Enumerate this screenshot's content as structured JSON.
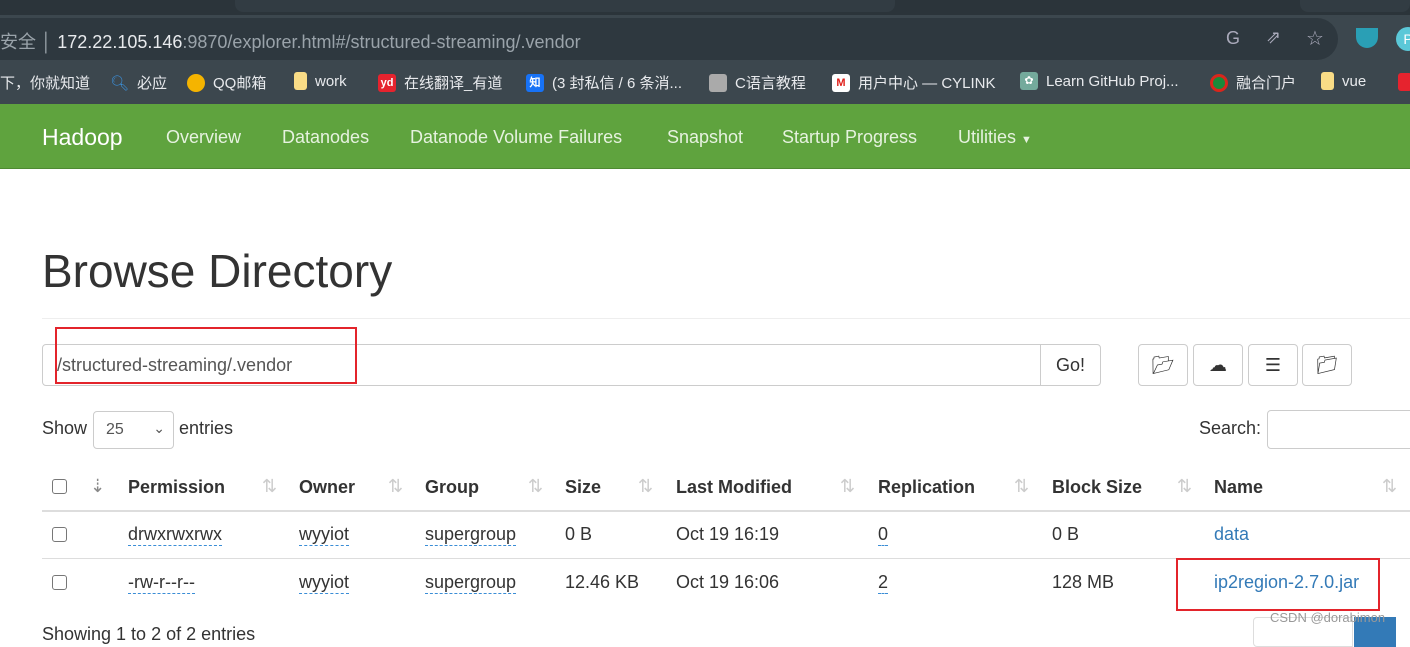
{
  "browser": {
    "url_host": "172.22.105.146",
    "url_rest": ":9870/explorer.html#/structured-streaming/.vendor",
    "security_label": "安全",
    "bookmarks": [
      {
        "label": "下，你就知道",
        "icon": "baidu-icon"
      },
      {
        "label": "必应",
        "icon": "bing-search-icon"
      },
      {
        "label": "QQ邮箱",
        "icon": "qq-mail-icon"
      },
      {
        "label": "work",
        "icon": "folder-icon"
      },
      {
        "label": "在线翻译_有道",
        "icon": "youdao-icon"
      },
      {
        "label": "(3 封私信 / 6 条消...",
        "icon": "zhihu-icon"
      },
      {
        "label": "C语言教程",
        "icon": "shield-icon"
      },
      {
        "label": "用户中心 — CYLINK",
        "icon": "m-logo-icon"
      },
      {
        "label": "Learn GitHub Proj...",
        "icon": "openai-icon"
      },
      {
        "label": "融合门户",
        "icon": "portal-icon"
      },
      {
        "label": "vue",
        "icon": "folder-icon"
      }
    ]
  },
  "navbar": {
    "brand": "Hadoop",
    "items": [
      "Overview",
      "Datanodes",
      "Datanode Volume Failures",
      "Snapshot",
      "Startup Progress",
      "Utilities"
    ],
    "color": "#5fa33e"
  },
  "page": {
    "title": "Browse Directory",
    "path": "/structured-streaming/.vendor",
    "go_label": "Go!",
    "show_label": "Show",
    "entries_label": "entries",
    "page_size": "25",
    "search_label": "Search:",
    "footer": "Showing 1 to 2 of 2 entries",
    "watermark": "CSDN @dorabimon"
  },
  "table": {
    "headers": [
      "Permission",
      "Owner",
      "Group",
      "Size",
      "Last Modified",
      "Replication",
      "Block Size",
      "Name"
    ],
    "rows": [
      {
        "permission": "drwxrwxrwx",
        "owner": "wyyiot",
        "group": "supergroup",
        "size": "0 B",
        "modified": "Oct 19 16:19",
        "replication": "0",
        "block_size": "0 B",
        "name": "data"
      },
      {
        "permission": "-rw-r--r--",
        "owner": "wyyiot",
        "group": "supergroup",
        "size": "12.46 KB",
        "modified": "Oct 19 16:06",
        "replication": "2",
        "block_size": "128 MB",
        "name": "ip2region-2.7.0.jar"
      }
    ]
  }
}
